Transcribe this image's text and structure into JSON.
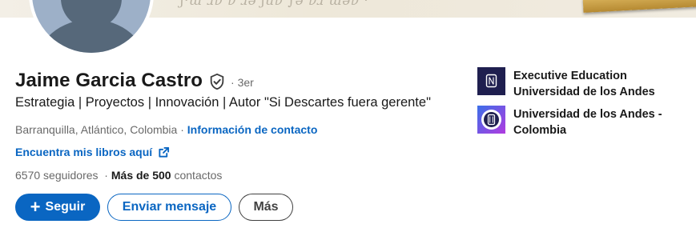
{
  "profile": {
    "name": "Jaime Garcia Castro",
    "degree": "· 3er",
    "headline": "Estrategia | Proyectos | Innovación | Autor \"Si Descartes fuera gerente\"",
    "location": "Barranquilla, Atlántico, Colombia",
    "location_separator": " · ",
    "contact_link": "Información de contacto",
    "books_link": "Encuentra mis libros aquí",
    "followers": "6570 seguidores",
    "stats_separator": "  · ",
    "connections": "Más de 500",
    "connections_suffix": " contactos"
  },
  "actions": {
    "follow": "Seguir",
    "message": "Enviar mensaje",
    "more": "Más"
  },
  "organizations": [
    {
      "line1": "Executive Education",
      "line2": "Universidad de los Andes"
    },
    {
      "line1": "Universidad de los Andes -",
      "line2": "Colombia"
    }
  ],
  "icons": {
    "verified": "shield-check-icon",
    "external": "external-link-icon",
    "plus": "plus-icon"
  },
  "colors": {
    "brand_blue": "#0a66c2",
    "org1_logo_bg": "#1f1f4f",
    "org2_logo_bg": "#5b3fd6"
  }
}
